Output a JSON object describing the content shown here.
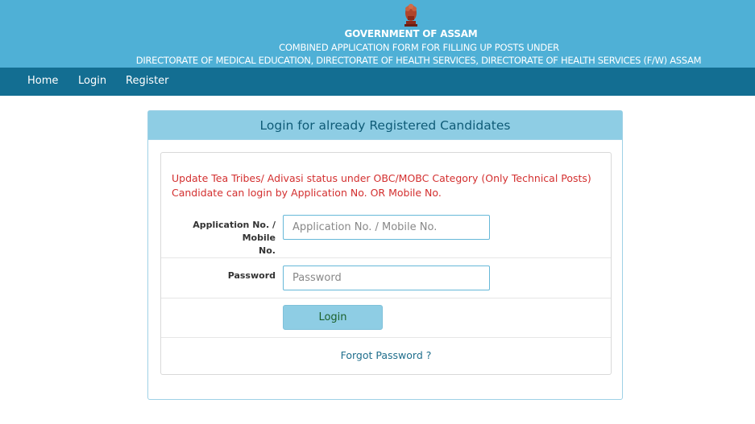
{
  "header": {
    "government": "GOVERNMENT OF ASSAM",
    "subtitle_line1": "COMBINED APPLICATION FORM FOR FILLING UP POSTS UNDER",
    "subtitle_line2": "DIRECTORATE OF MEDICAL EDUCATION, DIRECTORATE OF HEALTH SERVICES, DIRECTORATE OF HEALTH SERVICES (F/W) ASSAM",
    "emblem_icon": "national-emblem-icon"
  },
  "nav": {
    "items": [
      {
        "label": "Home"
      },
      {
        "label": "Login"
      },
      {
        "label": "Register"
      }
    ]
  },
  "panel": {
    "title": "Login for already Registered Candidates",
    "notice_line1": "Update Tea Tribes/ Adivasi status under OBC/MOBC Category (Only Technical Posts)",
    "notice_line2": "Candidate can login by Application No. OR Mobile No.",
    "app_label_line1": "Application No. / Mobile",
    "app_label_line2": "No.",
    "app_placeholder": "Application No. / Mobile No.",
    "password_label": "Password",
    "password_placeholder": "Password",
    "login_button": "Login",
    "forgot_link": "Forgot Password ?"
  },
  "colors": {
    "header_bg": "#4fb0d6",
    "nav_bg": "#136e92",
    "panel_head_bg": "#8ecde4",
    "notice_text": "#d32f2f"
  }
}
